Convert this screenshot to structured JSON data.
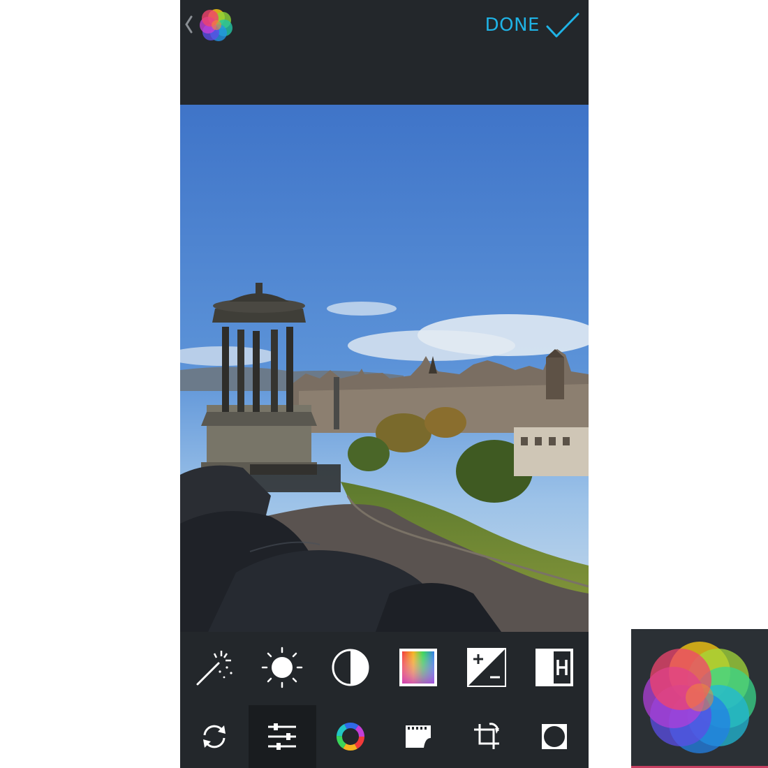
{
  "header": {
    "done_label": "DONE"
  },
  "icons": {
    "back": "chevron-left-icon",
    "app_logo": "afterlight-flower-icon",
    "done_check": "checkmark-icon"
  },
  "colors": {
    "toolbar_bg": "#23272b",
    "active_tab_bg": "#191c1f",
    "accent": "#1fb3e6"
  },
  "adjust_tools": [
    {
      "icon": "magic-wand-icon"
    },
    {
      "icon": "brightness-sun-icon"
    },
    {
      "icon": "contrast-icon"
    },
    {
      "icon": "saturation-gradient-icon"
    },
    {
      "icon": "exposure-plus-minus-icon"
    },
    {
      "icon": "highlights-h-icon"
    }
  ],
  "bottom_tabs": [
    {
      "icon": "refresh-icon",
      "active": false
    },
    {
      "icon": "adjust-sliders-icon",
      "active": true
    },
    {
      "icon": "filters-color-ring-icon",
      "active": false
    },
    {
      "icon": "film-frame-icon",
      "active": false
    },
    {
      "icon": "crop-rotate-icon",
      "active": false
    },
    {
      "icon": "vignette-circle-icon",
      "active": false
    }
  ]
}
